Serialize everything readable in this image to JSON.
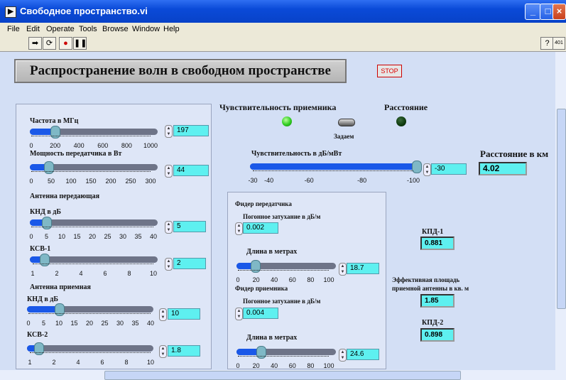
{
  "window": {
    "title": "Свободное пространство.vi"
  },
  "menu": [
    "File",
    "Edit",
    "Operate",
    "Tools",
    "Browse",
    "Window",
    "Help"
  ],
  "toolbar": {
    "help_glyph": "?",
    "run_mode_text": "401"
  },
  "heading": "Распространение волн в свободном пространстве",
  "stop_label": "STOP",
  "left": {
    "freq": {
      "label": "Частота в МГц",
      "ticks": [
        "0",
        "200",
        "400",
        "600",
        "800",
        "1000"
      ],
      "value": "197",
      "fraction": 0.197
    },
    "power": {
      "label": "Мощность передатчика в Вт",
      "ticks": [
        "0",
        "50",
        "100",
        "150",
        "200",
        "250",
        "300"
      ],
      "value": "44",
      "fraction": 0.147
    },
    "tx_antenna_title": "Антенна передающая",
    "tx_knd": {
      "label": "КНД в дБ",
      "ticks": [
        "0",
        "5",
        "10",
        "15",
        "20",
        "25",
        "30",
        "35",
        "40"
      ],
      "value": "5",
      "fraction": 0.125
    },
    "ksv1": {
      "label": "КСВ-1",
      "ticks": [
        "1",
        "2",
        "4",
        "6",
        "8",
        "10"
      ],
      "value": "2",
      "fraction": 0.111
    },
    "rx_antenna_title": "Антенна приемная",
    "rx_knd": {
      "label": "КНД в дБ",
      "ticks": [
        "0",
        "5",
        "10",
        "15",
        "20",
        "25",
        "30",
        "35",
        "40"
      ],
      "value": "10",
      "fraction": 0.25
    },
    "ksv2": {
      "label": "КСВ-2",
      "ticks": [
        "1",
        "2",
        "4",
        "6",
        "8",
        "10"
      ],
      "value": "1.8",
      "fraction": 0.089
    }
  },
  "mode": {
    "sensitivity_label": "Чувствительность приемника",
    "distance_label": "Расстояние",
    "switch_label": "Задаем"
  },
  "sensitivity": {
    "label": "Чувствительность в дБ/мВт",
    "ticks": [
      "-30",
      "-40",
      "-60",
      "-80",
      "-100"
    ],
    "value": "-30",
    "fraction": 1.0
  },
  "distance": {
    "label": "Расстояние в км",
    "value": "4.02"
  },
  "feeder": {
    "tx_title": "Фидер передатчика",
    "tx_loss_label": "Погонное затухание в дБ/м",
    "tx_loss_value": "0.002",
    "tx_len_label": "Длина в метрах",
    "tx_len_value": "18.7",
    "tx_len_fraction": 0.187,
    "rx_title": "Фидер приемника",
    "rx_loss_label": "Погонное затухание в дБ/м",
    "rx_loss_value": "0.004",
    "rx_len_label": "Длина в метрах",
    "rx_len_value": "24.6",
    "rx_len_fraction": 0.246,
    "len_ticks": [
      "0",
      "20",
      "40",
      "60",
      "80",
      "100"
    ]
  },
  "results": {
    "kpd1_label": "КПД-1",
    "kpd1_value": "0.881",
    "area_label_1": "Эффективная площадь",
    "area_label_2": "приемной антенны в кв. м",
    "area_value": "1.85",
    "kpd2_label": "КПД-2",
    "kpd2_value": "0.898"
  },
  "colors": {
    "indicator": "#5ef0f0",
    "led_on": "#2ecc20",
    "led_off": "#0d3a0d",
    "slider_fill": "#1a58e8"
  }
}
